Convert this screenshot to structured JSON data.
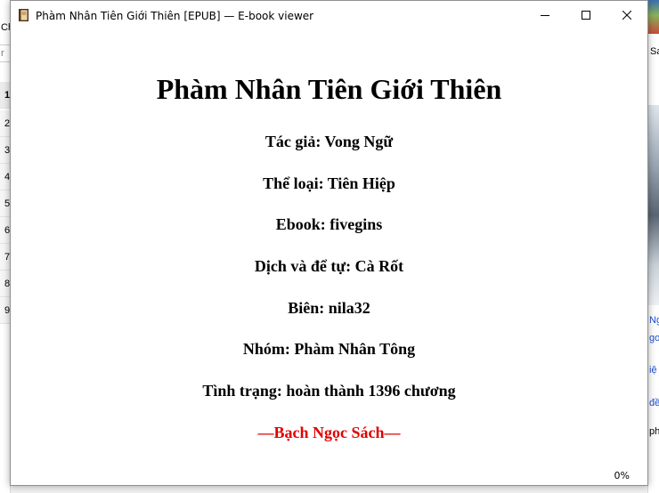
{
  "background_left": {
    "tab_fragment": "Ch",
    "filter_fragment": "r",
    "rows": [
      "1",
      "2",
      "3",
      "4",
      "5",
      "6",
      "7",
      "8",
      "9"
    ]
  },
  "background_right": {
    "header_fragment": "Sa",
    "link_fragments": [
      "Ng",
      "go",
      "iệ",
      "đề"
    ],
    "text_fragment": "ph"
  },
  "window": {
    "title": "Phàm Nhân Tiên Giới Thiên [EPUB] — E-book viewer",
    "controls": [
      "minimize",
      "maximize",
      "close"
    ]
  },
  "book": {
    "title": "Phàm Nhân Tiên Giới Thiên",
    "lines": [
      "Tác giả: Vong Ngữ",
      "Thể loại: Tiên Hiệp",
      "Ebook: fivegins",
      "Dịch và để tự: Cà Rốt",
      "Biên: nila32",
      "Nhóm: Phàm Nhân Tông",
      "Tình trạng: hoàn thành 1396 chương"
    ],
    "signature": "—Bạch Ngọc Sách—",
    "signature_color": "#e30000"
  },
  "status": {
    "progress": "0%"
  }
}
